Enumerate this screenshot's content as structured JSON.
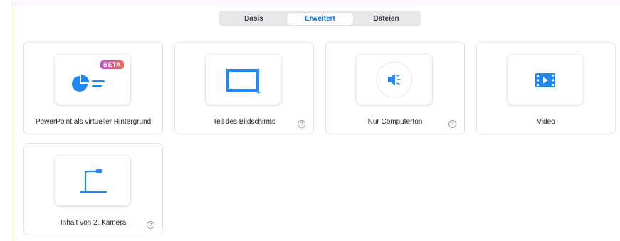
{
  "tabs": [
    {
      "label": "Basis",
      "active": false
    },
    {
      "label": "Erweitert",
      "active": true
    },
    {
      "label": "Dateien",
      "active": false
    }
  ],
  "options": [
    {
      "label": "PowerPoint als virtueller Hintergrund",
      "icon": "powerpoint-pie-icon",
      "badge": "BETA",
      "help": false
    },
    {
      "label": "Teil des Bildschirms",
      "icon": "screen-portion-icon",
      "help": true
    },
    {
      "label": "Nur Computerton",
      "icon": "speaker-icon",
      "help": true
    },
    {
      "label": "Video",
      "icon": "film-play-icon",
      "help": false
    },
    {
      "label": "Inhalt von 2. Kamera",
      "icon": "document-camera-icon",
      "help": true
    }
  ],
  "help_glyph": "?",
  "colors": {
    "accent": "#0e72ed",
    "icon_blue": "#1e88f5",
    "frame": "#e8a23a",
    "beta_gradient_start": "#c04bd9",
    "beta_gradient_end": "#f06b4b"
  }
}
